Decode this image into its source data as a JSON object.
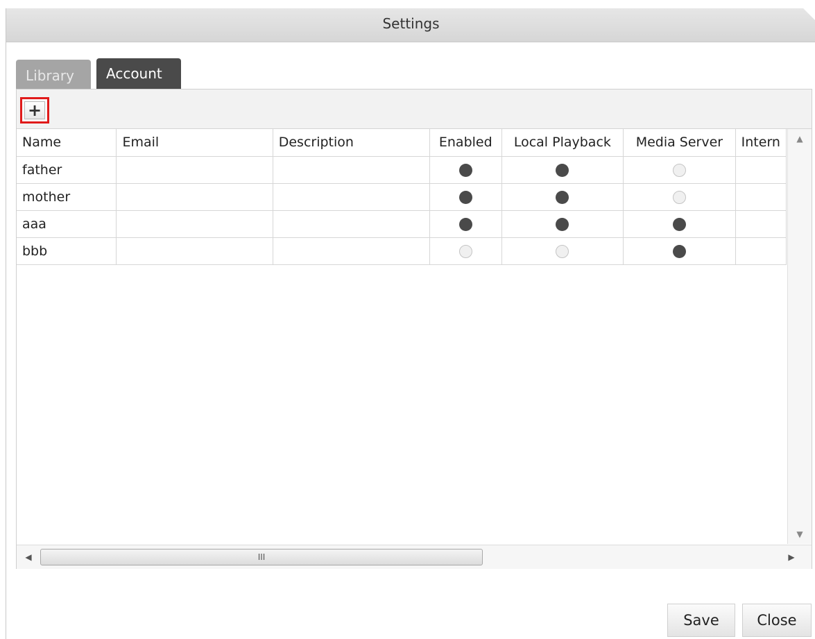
{
  "window": {
    "title": "Settings"
  },
  "tabs": [
    {
      "label": "Library",
      "active": false
    },
    {
      "label": "Account",
      "active": true
    }
  ],
  "toolbar": {
    "add_label": "+"
  },
  "table": {
    "columns": [
      "Name",
      "Email",
      "Description",
      "Enabled",
      "Local Playback",
      "Media Server",
      "Intern"
    ],
    "rows": [
      {
        "name": "father",
        "email": "",
        "description": "",
        "enabled": true,
        "local_playback": true,
        "media_server": false
      },
      {
        "name": "mother",
        "email": "",
        "description": "",
        "enabled": true,
        "local_playback": true,
        "media_server": false
      },
      {
        "name": "aaa",
        "email": "",
        "description": "",
        "enabled": true,
        "local_playback": true,
        "media_server": true
      },
      {
        "name": "bbb",
        "email": "",
        "description": "",
        "enabled": false,
        "local_playback": false,
        "media_server": true
      }
    ]
  },
  "scrollbars": {
    "up_icon": "▲",
    "down_icon": "▼",
    "left_icon": "◀",
    "right_icon": "▶",
    "grip": "III"
  },
  "footer": {
    "save_label": "Save",
    "close_label": "Close"
  },
  "colors": {
    "dot_on": "#4a4a4a",
    "dot_off": "#f0f0f0",
    "highlight": "#e01a1a",
    "active_tab": "#4a4a4a"
  }
}
